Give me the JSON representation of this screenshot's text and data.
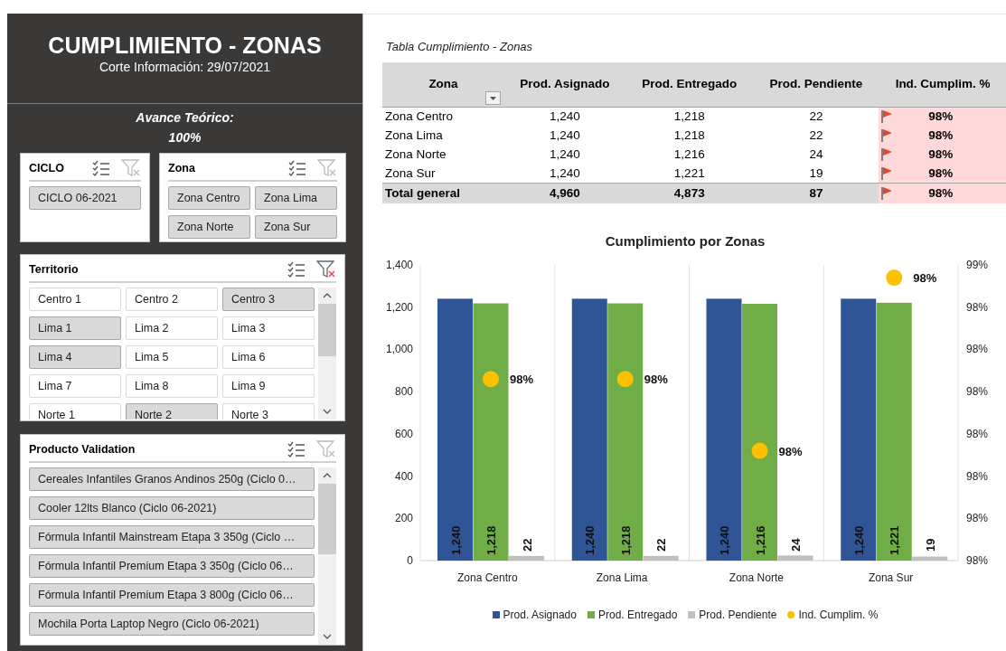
{
  "header": {
    "title": "CUMPLIMIENTO - ZONAS",
    "subtitle": "Corte Información: 29/07/2021"
  },
  "avance": {
    "label": "Avance Teórico:",
    "value": "100%"
  },
  "slicers": [
    {
      "title": "CICLO",
      "filtered": false,
      "items": [
        {
          "label": "CICLO 06-2021",
          "selected": true
        }
      ]
    },
    {
      "title": "Zona",
      "filtered": false,
      "items": [
        {
          "label": "Zona Centro",
          "selected": true
        },
        {
          "label": "Zona Lima",
          "selected": true
        },
        {
          "label": "Zona Norte",
          "selected": true
        },
        {
          "label": "Zona Sur",
          "selected": true
        }
      ]
    },
    {
      "title": "Territorio",
      "filtered": true,
      "scrollbar": true,
      "items": [
        {
          "label": "Centro 1",
          "selected": false
        },
        {
          "label": "Centro 2",
          "selected": false
        },
        {
          "label": "Centro 3",
          "selected": true
        },
        {
          "label": "Lima 1",
          "selected": true
        },
        {
          "label": "Lima 2",
          "selected": false
        },
        {
          "label": "Lima 3",
          "selected": false
        },
        {
          "label": "Lima 4",
          "selected": true
        },
        {
          "label": "Lima 5",
          "selected": false
        },
        {
          "label": "Lima 6",
          "selected": false
        },
        {
          "label": "Lima 7",
          "selected": false
        },
        {
          "label": "Lima 8",
          "selected": false
        },
        {
          "label": "Lima 9",
          "selected": false
        },
        {
          "label": "Norte 1",
          "selected": false
        },
        {
          "label": "Norte 2",
          "selected": true
        },
        {
          "label": "Norte 3",
          "selected": false
        }
      ]
    },
    {
      "title": "Producto Validation",
      "filtered": false,
      "scrollbar": true,
      "items": [
        {
          "label": "Cereales Infantiles Granos Andinos 250g (Ciclo 0…",
          "selected": true
        },
        {
          "label": "Cooler 12lts Blanco (Ciclo 06-2021)",
          "selected": true
        },
        {
          "label": "Fórmula Infantil Mainstream Etapa 3 350g (Ciclo …",
          "selected": true
        },
        {
          "label": "Fórmula Infantil Premium Etapa 3 350g (Ciclo 06…",
          "selected": true
        },
        {
          "label": "Fórmula Infantil Premium Etapa 3 800g (Ciclo 06…",
          "selected": true
        },
        {
          "label": "Mochila Porta Laptop Negro (Ciclo 06-2021)",
          "selected": true
        }
      ]
    }
  ],
  "table": {
    "title": "Tabla Cumplimiento - Zonas",
    "columns": [
      "Zona",
      "Prod. Asignado",
      "Prod. Entregado",
      "Prod. Pendiente",
      "Ind. Cumplim. %"
    ],
    "rows": [
      {
        "kind": "data",
        "cells": [
          "Zona Centro",
          "1,240",
          "1,218",
          "22",
          "98%"
        ]
      },
      {
        "kind": "data",
        "cells": [
          "Zona Lima",
          "1,240",
          "1,218",
          "22",
          "98%"
        ]
      },
      {
        "kind": "data",
        "cells": [
          "Zona Norte",
          "1,240",
          "1,216",
          "24",
          "98%"
        ]
      },
      {
        "kind": "data",
        "cells": [
          "Zona Sur",
          "1,240",
          "1,221",
          "19",
          "98%"
        ]
      },
      {
        "kind": "total",
        "cells": [
          "Total general",
          "4,960",
          "4,873",
          "87",
          "98%"
        ]
      }
    ]
  },
  "chart": {
    "chart_data": {
      "type": "bar",
      "title": "Cumplimiento por Zonas",
      "categories": [
        "Zona Centro",
        "Zona Lima",
        "Zona Norte",
        "Zona Sur"
      ],
      "series": [
        {
          "name": "Prod. Asignado",
          "color": "#2f5597",
          "values": [
            1240,
            1240,
            1240,
            1240
          ],
          "value_labels": [
            "1,240",
            "1,240",
            "1,240",
            "1,240"
          ]
        },
        {
          "name": "Prod. Entregado",
          "color": "#70ad47",
          "values": [
            1218,
            1218,
            1216,
            1221
          ],
          "value_labels": [
            "1,218",
            "1,218",
            "1,216",
            "1,221"
          ]
        },
        {
          "name": "Prod. Pendiente",
          "color": "#bfbfbf",
          "values": [
            22,
            22,
            24,
            19
          ],
          "value_labels": [
            "22",
            "22",
            "24",
            "19"
          ]
        },
        {
          "name": "Ind. Cumplim. %",
          "type": "scatter",
          "axis": "y2",
          "color": "#ffc000",
          "values": [
            0.9823,
            0.9823,
            0.9806,
            0.9847
          ],
          "value_labels": [
            "98%",
            "98%",
            "98%",
            "98%"
          ]
        }
      ],
      "legend": "bottom",
      "ylim": [
        0,
        1400
      ],
      "yticks": [
        {
          "value": 0,
          "label": "0"
        },
        {
          "value": 200,
          "label": "200"
        },
        {
          "value": 400,
          "label": "400"
        },
        {
          "value": 600,
          "label": "600"
        },
        {
          "value": 800,
          "label": "800"
        },
        {
          "value": 1000,
          "label": "1,000"
        },
        {
          "value": 1200,
          "label": "1,200"
        },
        {
          "value": 1400,
          "label": "1,400"
        }
      ],
      "y2lim": [
        0.978,
        0.985
      ],
      "y2ticks": [
        {
          "value": 0.978,
          "label": "98%"
        },
        {
          "value": 0.979,
          "label": "98%"
        },
        {
          "value": 0.98,
          "label": "98%"
        },
        {
          "value": 0.981,
          "label": "98%"
        },
        {
          "value": 0.982,
          "label": "98%"
        },
        {
          "value": 0.983,
          "label": "98%"
        },
        {
          "value": 0.984,
          "label": "98%"
        },
        {
          "value": 0.985,
          "label": "99%"
        }
      ],
      "orientation": "vertical"
    }
  }
}
